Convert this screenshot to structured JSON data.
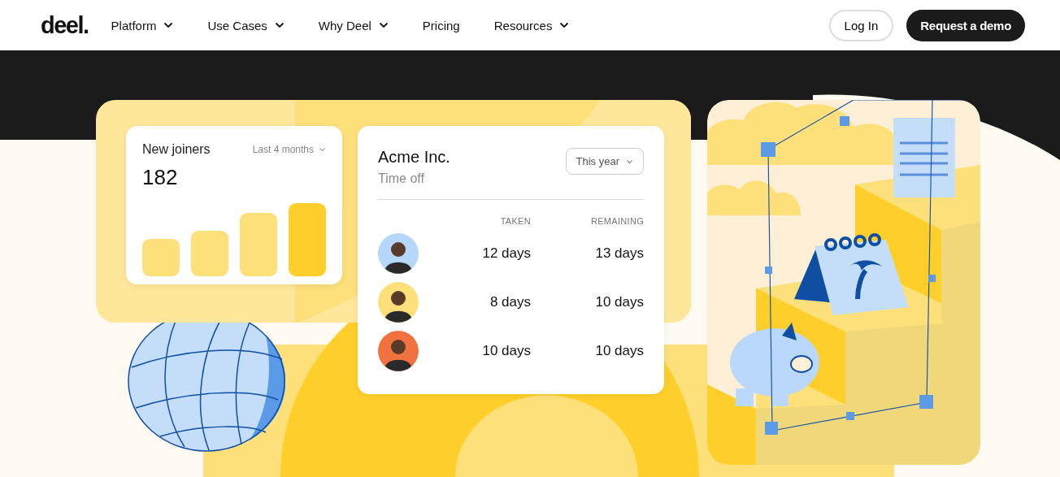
{
  "nav": {
    "logo": "deel.",
    "items": [
      {
        "label": "Platform",
        "has_menu": true
      },
      {
        "label": "Use Cases",
        "has_menu": true
      },
      {
        "label": "Why Deel",
        "has_menu": true
      },
      {
        "label": "Pricing",
        "has_menu": false
      },
      {
        "label": "Resources",
        "has_menu": true
      }
    ],
    "login": "Log In",
    "demo": "Request a demo"
  },
  "joiners": {
    "title": "New joiners",
    "period": "Last 4 months",
    "count": "182"
  },
  "timeoff": {
    "company": "Acme Inc.",
    "subtitle": "Time off",
    "period": "This year",
    "columns": [
      "TAKEN",
      "REMAINING"
    ],
    "rows": [
      {
        "color": "#b5d7fb",
        "taken": "12 days",
        "remaining": "13 days"
      },
      {
        "color": "#fde07a",
        "taken": "8 days",
        "remaining": "10 days"
      },
      {
        "color": "#f0733f",
        "taken": "10 days",
        "remaining": "10 days"
      }
    ]
  }
}
